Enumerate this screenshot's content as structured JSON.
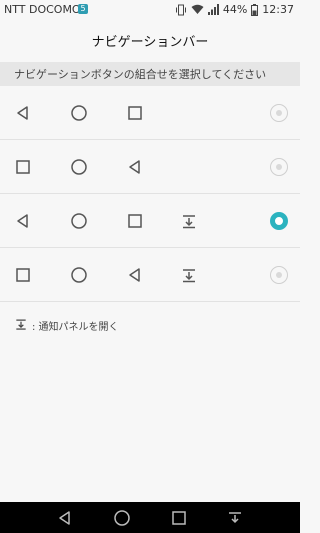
{
  "status_bar": {
    "carrier": "NTT DOCOMO",
    "sim_badge": "5",
    "battery": "44%",
    "time": "12:37"
  },
  "title": "ナビゲーションバー",
  "section_header": "ナビゲーションボタンの組合せを選択してください",
  "options": [
    {
      "buttons": [
        "back",
        "home",
        "recents"
      ],
      "selected": false
    },
    {
      "buttons": [
        "recents",
        "home",
        "back"
      ],
      "selected": false
    },
    {
      "buttons": [
        "back",
        "home",
        "recents",
        "notification"
      ],
      "selected": true
    },
    {
      "buttons": [
        "recents",
        "home",
        "back",
        "notification"
      ],
      "selected": false
    }
  ],
  "note": ": 通知パネルを開く",
  "colors": {
    "accent": "#2bb3bf",
    "background": "#f7f7f7",
    "navbar": "#000000"
  }
}
